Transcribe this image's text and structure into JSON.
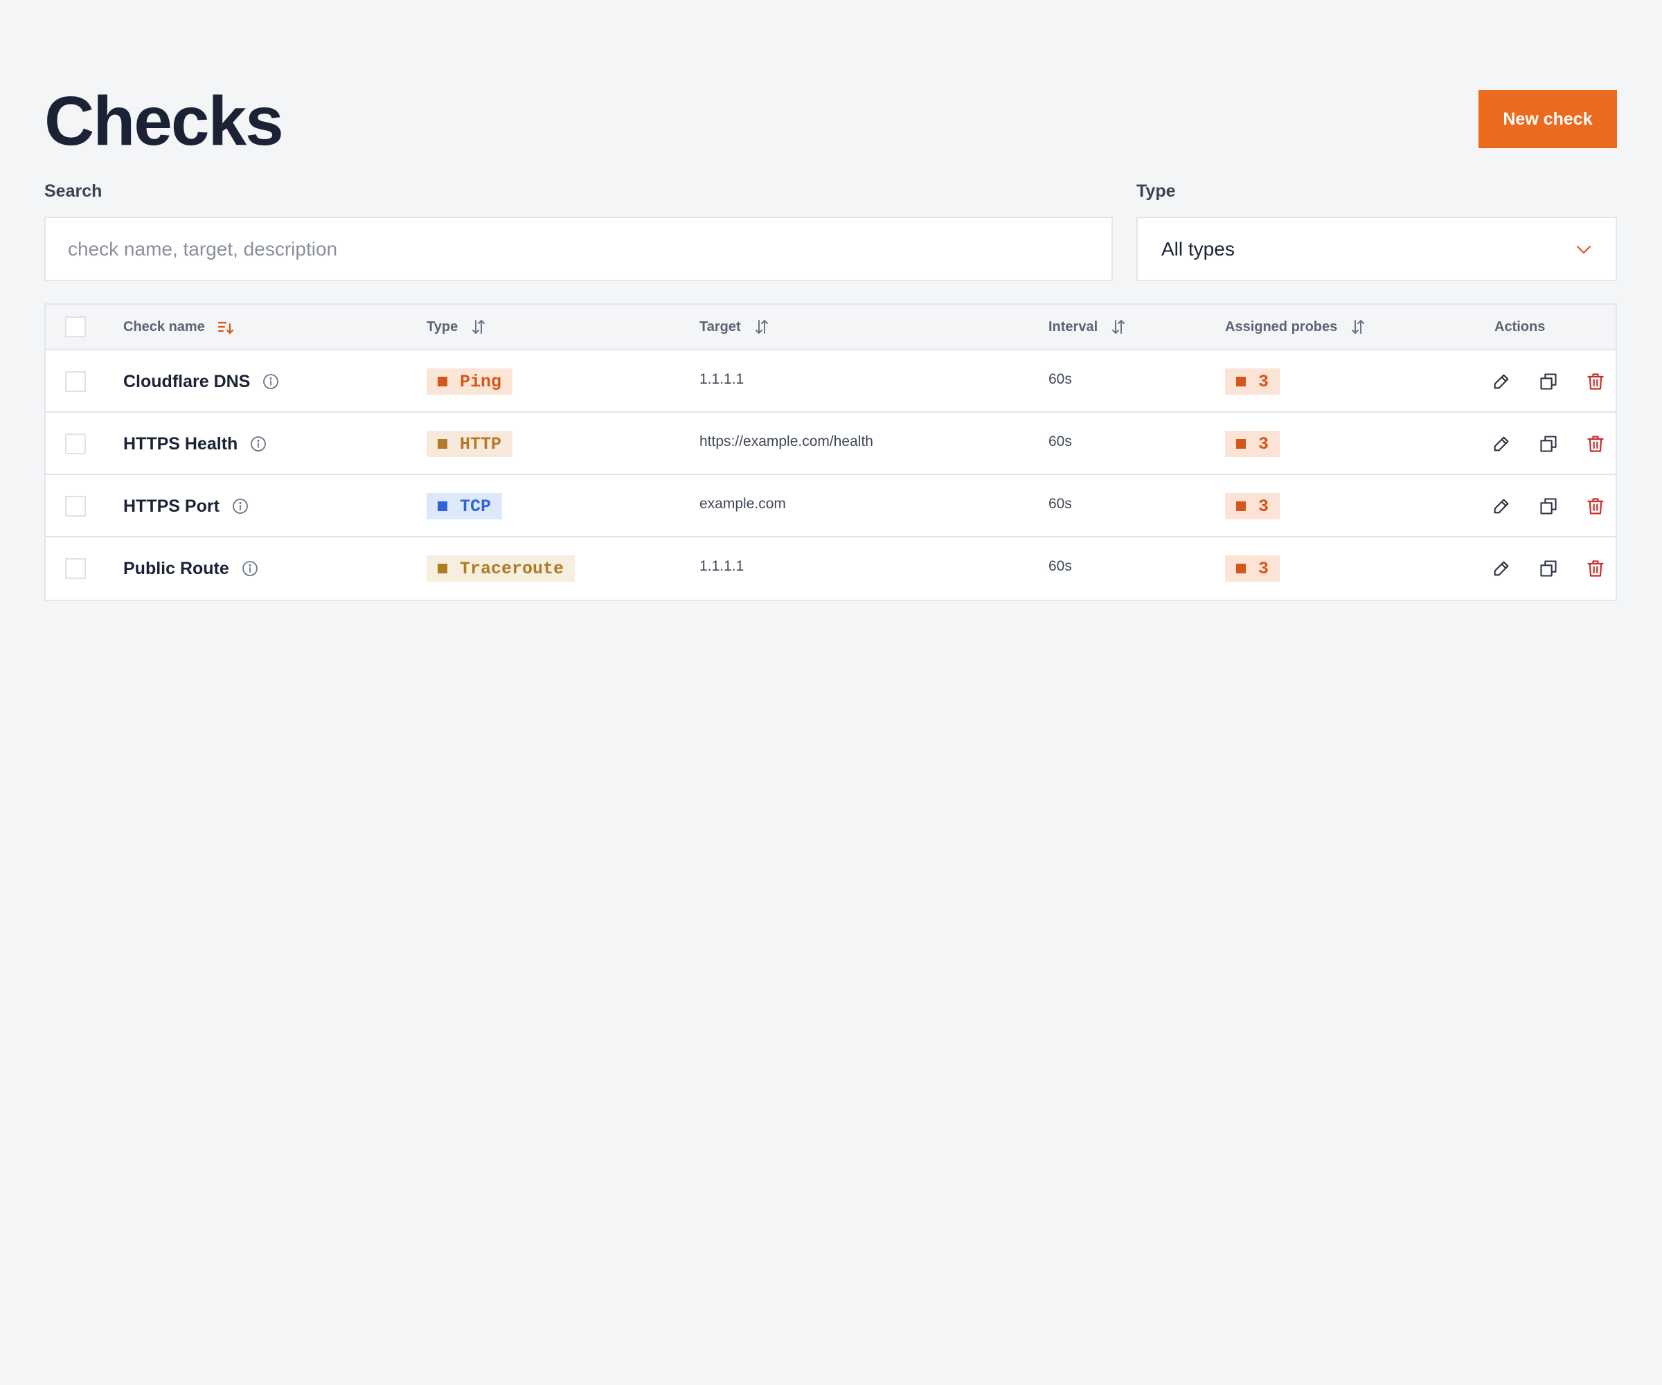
{
  "page": {
    "title": "Checks",
    "new_check_label": "New check"
  },
  "filters": {
    "search_label": "Search",
    "search_placeholder": "check name, target, description",
    "search_value": "",
    "type_label": "Type",
    "type_selected": "All types"
  },
  "table": {
    "columns": {
      "name": "Check name",
      "type": "Type",
      "target": "Target",
      "interval": "Interval",
      "probes": "Assigned probes",
      "actions": "Actions"
    },
    "rows": [
      {
        "name": "Cloudflare DNS",
        "type": "Ping",
        "target": "1.1.1.1",
        "interval": "60s",
        "probes": "3"
      },
      {
        "name": "HTTPS Health",
        "type": "HTTP",
        "target": "https://example.com/health",
        "interval": "60s",
        "probes": "3"
      },
      {
        "name": "HTTPS Port",
        "type": "TCP",
        "target": "example.com",
        "interval": "60s",
        "probes": "3"
      },
      {
        "name": "Public Route",
        "type": "Traceroute",
        "target": "1.1.1.1",
        "interval": "60s",
        "probes": "3"
      }
    ]
  },
  "colors": {
    "accent": "#ec6a1d",
    "ping_bg": "#fbe5d6",
    "ping_fg": "#d4571a",
    "http_bg": "#f7eadc",
    "http_fg": "#b6782a",
    "tcp_bg": "#dde8fa",
    "tcp_fg": "#2d64d8",
    "traceroute_bg": "#f6eedf",
    "traceroute_fg": "#b07a22",
    "probes_bg": "#fbe3d6",
    "probes_fg": "#d4571a",
    "delete": "#c9302c"
  },
  "icons": {
    "sort_active": "sort-descending-icon",
    "sort": "sort-updown-icon",
    "info": "info-circle-icon",
    "edit": "pencil-icon",
    "duplicate": "copy-icon",
    "delete": "trash-icon",
    "dropdown": "chevron-down-icon"
  }
}
